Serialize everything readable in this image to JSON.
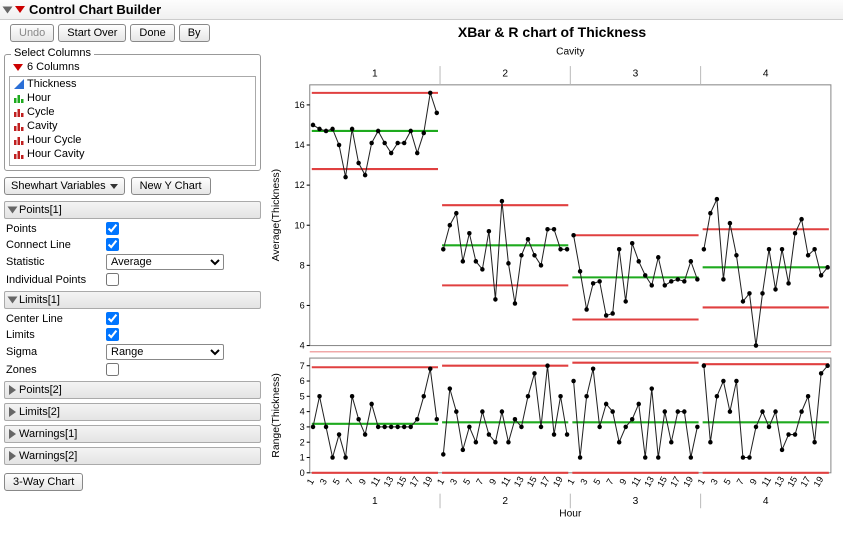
{
  "title": "Control Chart Builder",
  "toolbar": {
    "undo": "Undo",
    "start_over": "Start Over",
    "done": "Done",
    "by": "By"
  },
  "chart": {
    "title": "XBar & R chart of Thickness",
    "phase_header": "Cavity",
    "xlabel": "Hour"
  },
  "columns_panel": {
    "legend": "Select Columns",
    "count_label": "6 Columns"
  },
  "columns": [
    {
      "name": "Thickness",
      "icon": "tri-blue"
    },
    {
      "name": "Hour",
      "icon": "bars-green"
    },
    {
      "name": "Cycle",
      "icon": "bars-red"
    },
    {
      "name": "Cavity",
      "icon": "bars-red"
    },
    {
      "name": "Hour Cycle",
      "icon": "bars-red"
    },
    {
      "name": "Hour Cavity",
      "icon": "bars-red"
    }
  ],
  "chart_type_btn": "Shewhart Variables",
  "new_y_btn": "New Y Chart",
  "points1": {
    "head": "Points[1]",
    "points": "Points",
    "connect": "Connect Line",
    "stat": "Statistic",
    "stat_val": "Average",
    "indiv": "Individual Points"
  },
  "limits1": {
    "head": "Limits[1]",
    "center": "Center Line",
    "limits": "Limits",
    "sigma": "Sigma",
    "sigma_val": "Range",
    "zones": "Zones"
  },
  "headers": {
    "points2": "Points[2]",
    "limits2": "Limits[2]",
    "warn1": "Warnings[1]",
    "warn2": "Warnings[2]"
  },
  "three_way_btn": "3-Way Chart",
  "chart_data": {
    "type": "control-chart",
    "title": "XBar & R chart of Thickness",
    "phase_variable": "Cavity",
    "x_variable": "Hour",
    "phases": [
      "1",
      "2",
      "3",
      "4"
    ],
    "x_ticks": [
      1,
      3,
      5,
      7,
      9,
      11,
      13,
      15,
      17,
      19
    ],
    "upper": {
      "ylabel": "Average(Thickness)",
      "ylim": [
        4,
        17
      ],
      "y_ticks": [
        4,
        6,
        8,
        10,
        12,
        14,
        16
      ],
      "series": [
        {
          "phase": "1",
          "values": [
            15.0,
            14.8,
            14.7,
            14.8,
            14.0,
            12.4,
            14.8,
            13.1,
            12.5,
            14.1,
            14.7,
            14.1,
            13.6,
            14.1,
            14.1,
            14.7,
            13.6,
            14.6,
            16.6,
            15.6
          ],
          "center": 14.7,
          "ucl": 16.6,
          "lcl": 12.8
        },
        {
          "phase": "2",
          "values": [
            8.8,
            10.0,
            10.6,
            8.2,
            9.6,
            8.2,
            7.8,
            9.7,
            6.3,
            11.2,
            8.1,
            6.1,
            8.5,
            9.3,
            8.5,
            8.0,
            9.8,
            9.8,
            8.8,
            8.8
          ],
          "center": 9.0,
          "ucl": 11.0,
          "lcl": 7.0
        },
        {
          "phase": "3",
          "values": [
            9.5,
            7.7,
            5.8,
            7.1,
            7.2,
            5.5,
            5.6,
            8.8,
            6.2,
            9.1,
            8.2,
            7.5,
            7.0,
            8.4,
            7.0,
            7.2,
            7.3,
            7.2,
            8.2,
            7.3
          ],
          "center": 7.4,
          "ucl": 9.5,
          "lcl": 5.3
        },
        {
          "phase": "4",
          "values": [
            8.8,
            10.6,
            11.3,
            7.3,
            10.1,
            8.5,
            6.2,
            6.6,
            4.0,
            6.6,
            8.8,
            6.8,
            8.8,
            7.1,
            9.6,
            10.3,
            8.5,
            8.8,
            7.5,
            7.9
          ],
          "center": 7.9,
          "ucl": 9.8,
          "lcl": 5.9
        }
      ]
    },
    "lower": {
      "ylabel": "Range(Thickness)",
      "ylim": [
        0,
        7.5
      ],
      "y_ticks": [
        0,
        1,
        2,
        3,
        4,
        5,
        6,
        7
      ],
      "series": [
        {
          "phase": "1",
          "values": [
            3,
            5,
            3,
            1,
            2.5,
            1,
            5,
            3.5,
            2.5,
            4.5,
            3,
            3,
            3,
            3,
            3,
            3,
            3.5,
            5,
            6.8,
            3.5
          ],
          "center": 3.2,
          "ucl": 6.9,
          "lcl": 0
        },
        {
          "phase": "2",
          "values": [
            1.2,
            5.5,
            4,
            1.5,
            3,
            2,
            4,
            2.5,
            2,
            4,
            2,
            3.5,
            3,
            5,
            6.5,
            3,
            7,
            2.5,
            5,
            2.5
          ],
          "center": 3.3,
          "ucl": 7.0,
          "lcl": 0
        },
        {
          "phase": "3",
          "values": [
            6,
            1,
            5,
            6.8,
            3,
            4.5,
            4,
            2,
            3,
            3.5,
            4.5,
            1,
            5.5,
            1,
            4,
            2,
            4,
            4,
            1,
            3
          ],
          "center": 3.3,
          "ucl": 7.2,
          "lcl": 0
        },
        {
          "phase": "4",
          "values": [
            7,
            2,
            5,
            6,
            4,
            6,
            1,
            1,
            3,
            4,
            3,
            4,
            1.5,
            2.5,
            2.5,
            4,
            5,
            2,
            6.5,
            7
          ],
          "center": 3.3,
          "ucl": 7.1,
          "lcl": 0
        }
      ]
    }
  }
}
